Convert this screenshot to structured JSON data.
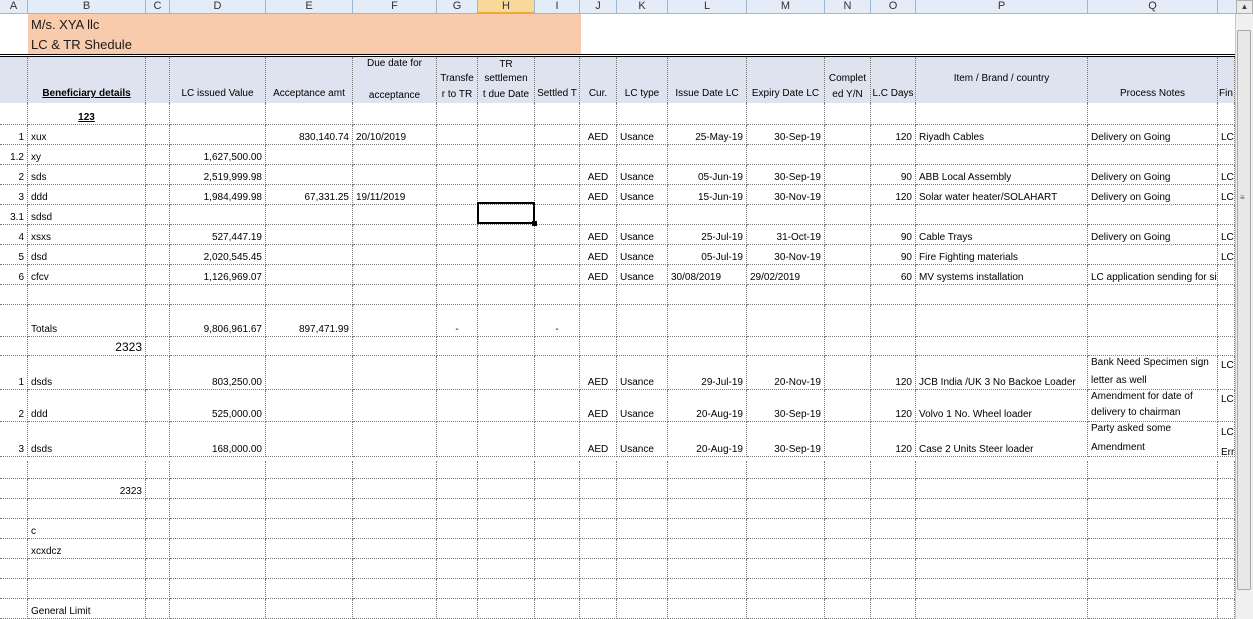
{
  "columns": [
    "A",
    "B",
    "C",
    "D",
    "E",
    "F",
    "G",
    "H",
    "I",
    "J",
    "K",
    "L",
    "M",
    "N",
    "O",
    "P",
    "Q"
  ],
  "selected_column": "H",
  "company": "M/s. XYA llc",
  "schedule_title": "LC & TR Shedule",
  "headers": {
    "beneficiary": "Beneficiary details",
    "lc_issued": "LC issued Value",
    "acceptance": "Acceptance amt",
    "due_date_1": "Due date for",
    "due_date_2": "acceptance",
    "transfer_1": "Transfe",
    "transfer_2": "r to TR",
    "tr_1": "TR",
    "tr_2": "settlemen",
    "tr_3": "t due Date",
    "settled": "Settled T",
    "cur": "Cur.",
    "lc_type": "LC type",
    "issue_date": "Issue Date LC",
    "expiry_date": "Expiry Date LC",
    "complete_1": "Complet",
    "complete_2": "ed Y/N",
    "lc_days": "L.C Days",
    "item": "Item / Brand / country",
    "process_notes": "Process Notes",
    "fin": "Fin"
  },
  "group1_label": "123",
  "rows1": [
    {
      "no": "1",
      "name": "xux",
      "lc": "",
      "acc": "830,140.74",
      "due": "20/10/2019",
      "cur": "AED",
      "type": "Usance",
      "issue": "25-May-19",
      "expiry": "30-Sep-19",
      "days": "120",
      "item": "Riyadh Cables",
      "notes": "Delivery on Going",
      "fin": "LC"
    },
    {
      "no": "1.2",
      "name": "xy",
      "lc": "1,627,500.00",
      "acc": "",
      "due": "",
      "cur": "",
      "type": "",
      "issue": "",
      "expiry": "",
      "days": "",
      "item": "",
      "notes": "",
      "fin": ""
    },
    {
      "no": "2",
      "name": "sds",
      "lc": "2,519,999.98",
      "acc": "",
      "due": "",
      "cur": "AED",
      "type": "Usance",
      "issue": "05-Jun-19",
      "expiry": "30-Sep-19",
      "days": "90",
      "item": "ABB Local Assembly",
      "notes": "Delivery on Going",
      "fin": "LC"
    },
    {
      "no": "3",
      "name": "ddd",
      "lc": "1,984,499.98",
      "acc": "67,331.25",
      "due": "19/11/2019",
      "cur": "AED",
      "type": "Usance",
      "issue": "15-Jun-19",
      "expiry": "30-Nov-19",
      "days": "120",
      "item": "Solar water heater/SOLAHART",
      "notes": "Delivery on Going",
      "fin": "LC"
    },
    {
      "no": "3.1",
      "name": "sdsd",
      "lc": "",
      "acc": "",
      "due": "",
      "cur": "",
      "type": "",
      "issue": "",
      "expiry": "",
      "days": "",
      "item": "",
      "notes": "",
      "fin": ""
    },
    {
      "no": "4",
      "name": "xsxs",
      "lc": "527,447.19",
      "acc": "",
      "due": "",
      "cur": "AED",
      "type": "Usance",
      "issue": "25-Jul-19",
      "expiry": "31-Oct-19",
      "days": "90",
      "item": "Cable Trays",
      "notes": "Delivery on Going",
      "fin": "LC"
    },
    {
      "no": "5",
      "name": "dsd",
      "lc": "2,020,545.45",
      "acc": "",
      "due": "",
      "cur": "AED",
      "type": "Usance",
      "issue": "05-Jul-19",
      "expiry": "30-Nov-19",
      "days": "90",
      "item": "Fire Fighting materials",
      "notes": "",
      "fin": "LC"
    },
    {
      "no": "6",
      "name": "cfcv",
      "lc": "1,126,969.07",
      "acc": "",
      "due": "",
      "cur": "AED",
      "type": "Usance",
      "issue": "30/08/2019",
      "expiry": "29/02/2019",
      "days": "60",
      "item": "MV systems installation",
      "notes": "LC application sending for sign",
      "fin": ""
    }
  ],
  "totals": {
    "label": "Totals",
    "lc": "9,806,961.67",
    "acc": "897,471.99",
    "g": "-",
    "i": "-"
  },
  "group2_label": "2323",
  "rows2": [
    {
      "no": "1",
      "name": "dsds",
      "lc": "803,250.00",
      "cur": "AED",
      "type": "Usance",
      "issue": "29-Jul-19",
      "expiry": "20-Nov-19",
      "days": "120",
      "item": "JCB India /UK 3 No Backoe Loader",
      "notes1": "Bank Need Specimen sign",
      "notes2": "letter as well",
      "fin": "LC"
    },
    {
      "no": "2",
      "name": "ddd",
      "lc": "525,000.00",
      "cur": "AED",
      "type": "Usance",
      "issue": "20-Aug-19",
      "expiry": "30-Sep-19",
      "days": "120",
      "item": "Volvo 1 No. Wheel loader",
      "notes1": "Amendment for date of",
      "notes2": "delivery to chairman",
      "fin": "LC"
    },
    {
      "no": "3",
      "name": "dsds",
      "lc": "168,000.00",
      "cur": "AED",
      "type": "Usance",
      "issue": "20-Aug-19",
      "expiry": "30-Sep-19",
      "days": "120",
      "item": "Case 2 Units Steer loader",
      "notes1": "Party asked some",
      "notes2": "Amendment",
      "fin": "LC",
      "fin2": "Erro"
    }
  ],
  "sub_2323": "2323",
  "misc": {
    "c": "c",
    "xcx": "xcxdcz",
    "general": "General Limit"
  }
}
